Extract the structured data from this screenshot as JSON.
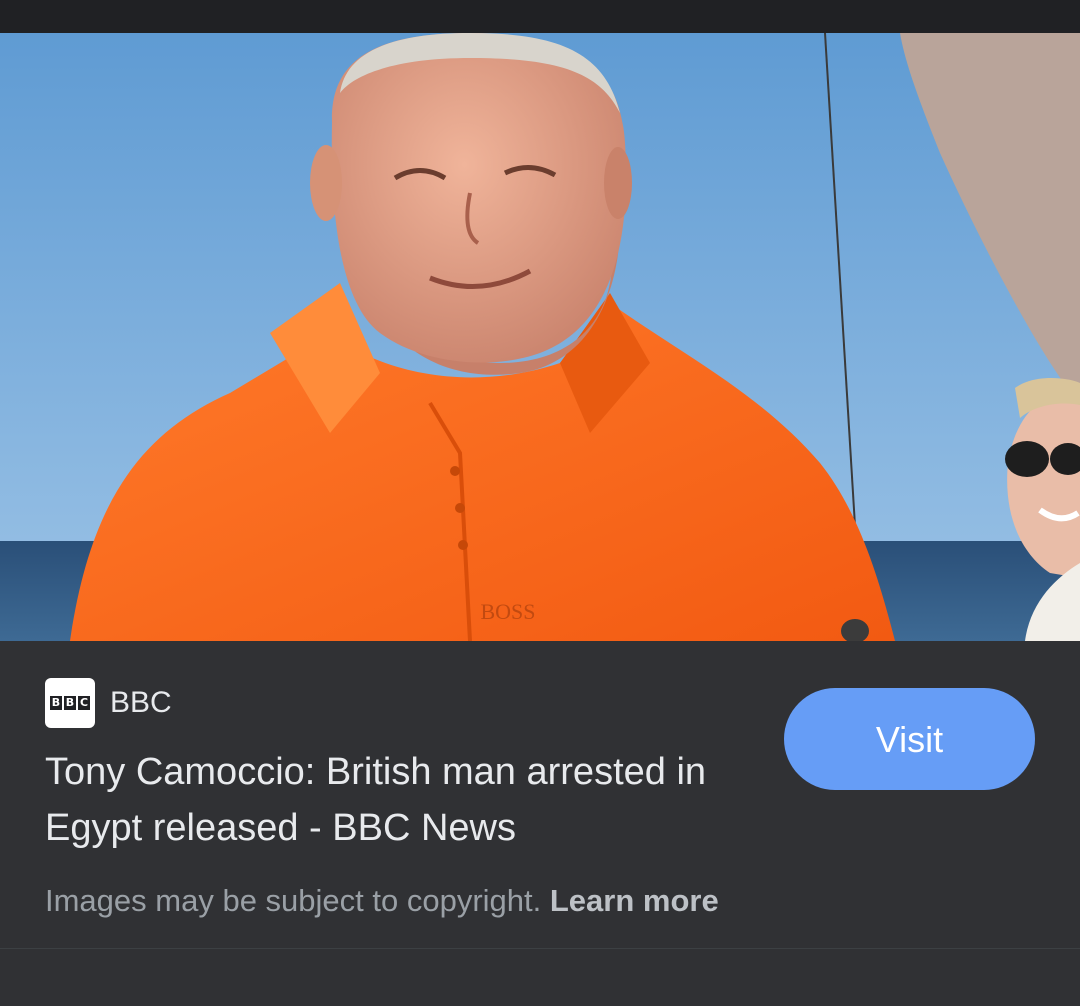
{
  "result": {
    "source": {
      "logo_text": "BBC",
      "name": "BBC"
    },
    "title": "Tony Camoccio: British man arrested in Egypt released - BBC News",
    "visit_label": "Visit",
    "copyright_text": "Images may be subject to copyright.",
    "learn_more_label": "Learn more",
    "image_shirt_logo": "BOSS"
  },
  "colors": {
    "background": "#303134",
    "visit_button": "#669df6",
    "title_text": "#e8eaed",
    "muted_text": "#9aa0a6"
  }
}
